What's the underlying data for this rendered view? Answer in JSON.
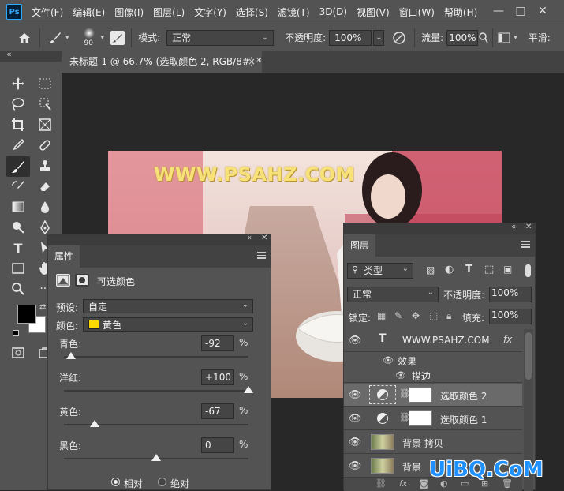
{
  "app": {
    "logo": "Ps"
  },
  "menu": [
    "文件(F)",
    "编辑(E)",
    "图像(I)",
    "图层(L)",
    "文字(Y)",
    "选择(S)",
    "滤镜(T)",
    "3D(D)",
    "视图(V)",
    "窗口(W)",
    "帮助(H)"
  ],
  "window_controls": {
    "minimize": "—",
    "restore": "□",
    "close": "✕"
  },
  "options": {
    "brush_size": "90",
    "mode_label": "模式:",
    "mode_value": "正常",
    "opacity_label": "不透明度:",
    "opacity_value": "100%",
    "flow_label": "流量:",
    "flow_value": "100%",
    "smooth_label": "平滑:"
  },
  "document": {
    "tab_title": "未标题-1 @ 66.7% (选取颜色 2, RGB/8#) *",
    "close": "×",
    "watermark_text": "WWW.PSAHZ.COM"
  },
  "properties": {
    "tab": "属性",
    "title": "可选颜色",
    "preset_label": "预设:",
    "preset_value": "自定",
    "color_label": "颜色:",
    "color_value": "黄色",
    "color_swatch": "#ffd800",
    "sliders": [
      {
        "label": "青色:",
        "value": "-92",
        "pct": "%",
        "level": -92
      },
      {
        "label": "洋红:",
        "value": "+100",
        "pct": "%",
        "level": 100
      },
      {
        "label": "黄色:",
        "value": "-67",
        "pct": "%",
        "level": -67
      },
      {
        "label": "黑色:",
        "value": "0",
        "pct": "%",
        "level": 0
      }
    ],
    "method_relative": "相对",
    "method_absolute": "绝对"
  },
  "layers": {
    "tab": "图层",
    "filter_label": "类型",
    "blend_mode": "正常",
    "opacity_label": "不透明度:",
    "opacity_value": "100%",
    "lock_label": "锁定:",
    "fill_label": "填充:",
    "fill_value": "100%",
    "text_layer": "WWW.PSAHZ.COM",
    "fx": "fx",
    "effects_label": "效果",
    "stroke_label": "描边",
    "adj2": "选取颜色 2",
    "adj1": "选取颜色 1",
    "bg_copy": "背景 拷贝",
    "bg": "背景"
  },
  "site_watermark": "UiBQ.CoM",
  "colors": {
    "accent": "#31a8ff",
    "panel": "#535353",
    "text_layer_yellow": "#f7e27a"
  }
}
